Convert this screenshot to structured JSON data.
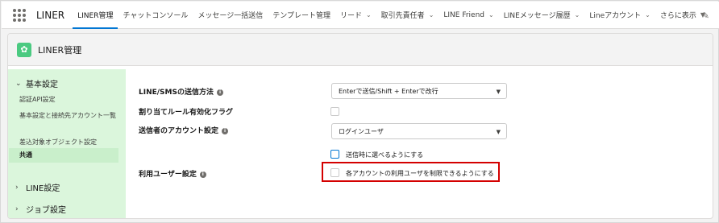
{
  "app": {
    "name": "LINER"
  },
  "nav": {
    "items": [
      {
        "label": "LINER管理",
        "active": true,
        "has_chevron": false
      },
      {
        "label": "チャットコンソール",
        "has_chevron": false
      },
      {
        "label": "メッセージ一括送信",
        "has_chevron": false
      },
      {
        "label": "テンプレート管理",
        "has_chevron": false
      },
      {
        "label": "リード",
        "has_chevron": true
      },
      {
        "label": "取引先責任者",
        "has_chevron": true
      },
      {
        "label": "LINE Friend",
        "has_chevron": true
      },
      {
        "label": "LINEメッセージ履歴",
        "has_chevron": true
      },
      {
        "label": "Lineアカウント",
        "has_chevron": true
      },
      {
        "label": "さらに表示",
        "has_chevron": true
      }
    ]
  },
  "page": {
    "title": "LINER管理"
  },
  "sidebar": {
    "groups": [
      {
        "label": "基本設定",
        "expanded": true,
        "items": [
          {
            "label": "認証API設定"
          },
          {
            "label": "基本設定と接続先アカウント一覧"
          },
          {
            "label": "差込対象オブジェクト設定"
          },
          {
            "label": "共通",
            "selected": true
          }
        ]
      },
      {
        "label": "LINE設定",
        "expanded": false
      },
      {
        "label": "ジョブ設定",
        "expanded": false
      }
    ]
  },
  "form": {
    "send_method": {
      "label": "LINE/SMSの送信方法",
      "value": "Enterで送信/Shift + Enterで改行"
    },
    "assign_rule": {
      "label": "割り当てルール有効化フラグ",
      "checked": false
    },
    "sender_account": {
      "label": "送信者のアカウント設定",
      "value": "ログインユーザ",
      "option_label": "送信時に選べるようにする",
      "option_checked": false
    },
    "user_setting": {
      "label": "利用ユーザー設定",
      "option_label": "各アカウントの利用ユーザを制限できるようにする",
      "option_checked": false
    }
  },
  "colors": {
    "accent": "#0176d3",
    "sidebar_bg": "#dbf6dc",
    "highlight": "#d40000",
    "app_icon": "#4bca81"
  }
}
